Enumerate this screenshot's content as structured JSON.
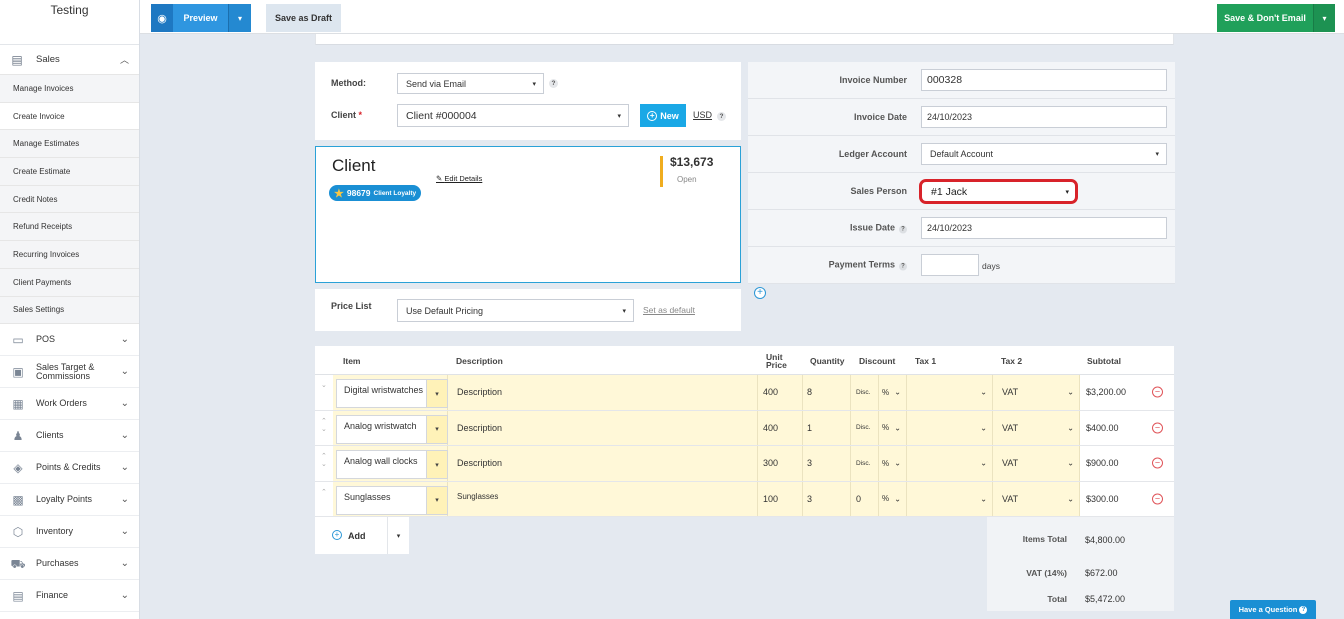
{
  "sidebar": {
    "brand": "Testing",
    "section": "Sales",
    "sub_items": [
      "Manage Invoices",
      "Create Invoice",
      "Manage Estimates",
      "Create Estimate",
      "Credit Notes",
      "Refund Receipts",
      "Recurring Invoices",
      "Client Payments",
      "Sales Settings"
    ],
    "main_items": [
      "POS",
      "Sales Target & Commissions",
      "Work Orders",
      "Clients",
      "Points & Credits",
      "Loyalty Points",
      "Inventory",
      "Purchases",
      "Finance"
    ]
  },
  "toolbar": {
    "preview_label": "Preview",
    "draft_label": "Save as Draft",
    "save_label": "Save & Don't Email"
  },
  "form": {
    "method_label": "Method:",
    "method_value": "Send via Email",
    "client_label": "Client",
    "client_required": "*",
    "client_value": "Client #000004",
    "new_label": "New",
    "currency": "USD",
    "price_list_label": "Price List",
    "price_list_value": "Use Default Pricing",
    "set_default_label": "Set as default"
  },
  "client_card": {
    "name": "Client",
    "loyalty_points": "98679",
    "loyalty_label": "Client Loyalty",
    "edit_label": "Edit Details",
    "balance": "$13,673",
    "balance_status": "Open"
  },
  "invoice": {
    "number_label": "Invoice Number",
    "number_value": "000328",
    "date_label": "Invoice Date",
    "date_value": "24/10/2023",
    "ledger_label": "Ledger Account",
    "ledger_value": "Default Account",
    "sales_person_label": "Sales Person",
    "sales_person_value": "#1 Jack",
    "issue_label": "Issue Date",
    "issue_value": "24/10/2023",
    "terms_label": "Payment Terms",
    "terms_value": "",
    "terms_unit": "days"
  },
  "table": {
    "headers": {
      "item": "Item",
      "description": "Description",
      "unit_price": "Unit Price",
      "quantity": "Quantity",
      "discount": "Discount",
      "tax1": "Tax 1",
      "tax2": "Tax 2",
      "subtotal": "Subtotal"
    },
    "rows": [
      {
        "item": "Digital wristwatches",
        "description": "Description",
        "unit_price": "400",
        "quantity": "8",
        "discount": "Disc.",
        "disc_type": "%",
        "tax2": "VAT",
        "subtotal": "$3,200.00"
      },
      {
        "item": "Analog wristwatch",
        "description": "Description",
        "unit_price": "400",
        "quantity": "1",
        "discount": "Disc.",
        "disc_type": "%",
        "tax2": "VAT",
        "subtotal": "$400.00"
      },
      {
        "item": "Analog wall clocks",
        "description": "Description",
        "unit_price": "300",
        "quantity": "3",
        "discount": "Disc.",
        "disc_type": "%",
        "tax2": "VAT",
        "subtotal": "$900.00"
      },
      {
        "item": "Sunglasses",
        "description": "Sunglasses",
        "unit_price": "100",
        "quantity": "3",
        "discount": "0",
        "disc_type": "%",
        "tax2": "VAT",
        "subtotal": "$300.00"
      }
    ],
    "add_label": "Add"
  },
  "totals": {
    "items_total_label": "Items Total",
    "items_total": "$4,800.00",
    "vat_label": "VAT (14%)",
    "vat": "$672.00",
    "total_label": "Total",
    "total": "$5,472.00"
  },
  "help": {
    "have_question": "Have a Question"
  },
  "colors": {
    "primary": "#2f96e0",
    "success": "#20a05a",
    "highlight_outline": "#d8232a",
    "row_fill": "#fff8d8"
  }
}
